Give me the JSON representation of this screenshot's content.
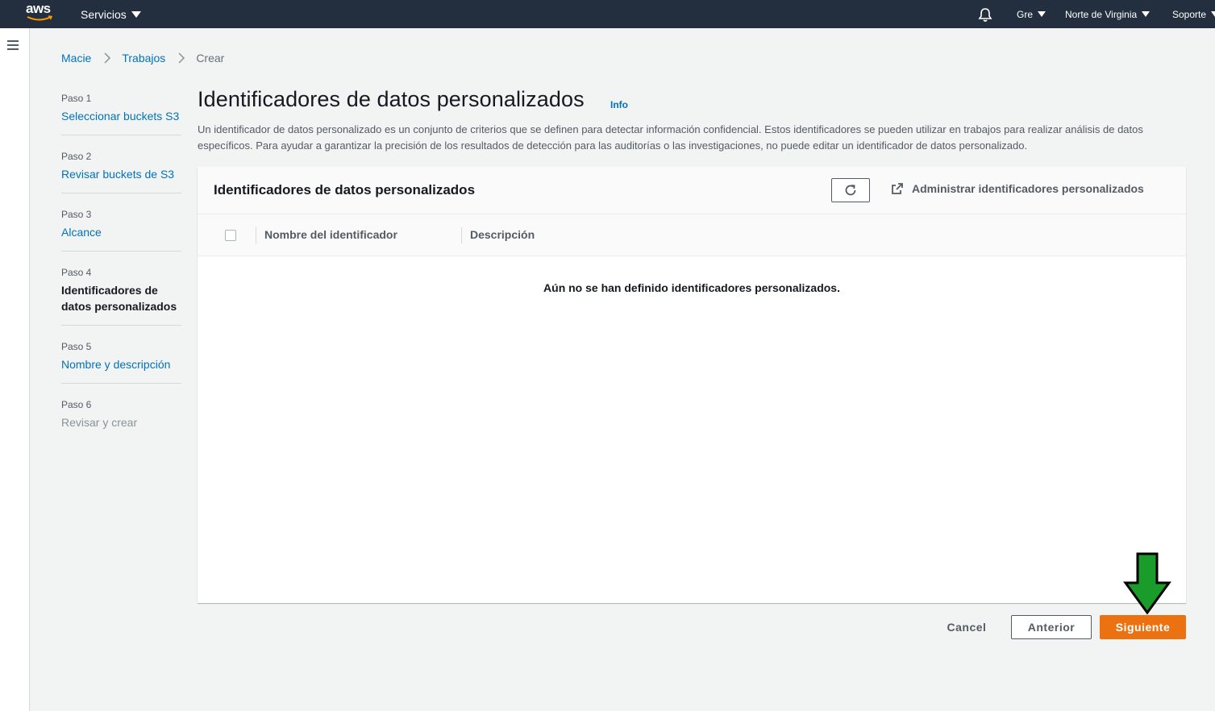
{
  "topnav": {
    "logo_text": "aws",
    "services": "Servicios",
    "user": "Gre",
    "region": "Norte de Virginia",
    "support": "Soporte",
    "bg_color": "#232f3e"
  },
  "breadcrumb": {
    "items": [
      "Macie",
      "Trabajos"
    ],
    "current": "Crear"
  },
  "steps": [
    {
      "num": "Paso 1",
      "label": "Seleccionar buckets S3",
      "state": "link"
    },
    {
      "num": "Paso 2",
      "label": "Revisar buckets de S3",
      "state": "link"
    },
    {
      "num": "Paso 3",
      "label": "Alcance",
      "state": "link"
    },
    {
      "num": "Paso 4",
      "label": "Identificadores de datos personalizados",
      "state": "current"
    },
    {
      "num": "Paso 5",
      "label": "Nombre y descripción",
      "state": "link"
    },
    {
      "num": "Paso 6",
      "label": "Revisar y crear",
      "state": "disabled"
    }
  ],
  "page": {
    "title": "Identificadores de datos personalizados",
    "info": "Info",
    "description": "Un identificador de datos personalizado es un conjunto de criterios que se definen para detectar información confidencial. Estos identificadores se pueden utilizar en trabajos para realizar análisis de datos específicos. Para ayudar a garantizar la precisión de los resultados de detección para las auditorías o las investigaciones, no puede editar un identificador de datos personalizado."
  },
  "container": {
    "title": "Identificadores de datos personalizados",
    "manage_link": "Administrar identificadores personalizados",
    "columns": [
      "Nombre del identificador",
      "Descripción"
    ],
    "empty_message": "Aún no se han definido identificadores personalizados."
  },
  "footer": {
    "cancel": "Cancel",
    "previous": "Anterior",
    "next": "Siguiente"
  },
  "colors": {
    "primary_button": "#ec7211",
    "link": "#0073bb",
    "annotation_arrow": "#1a9c2a"
  },
  "icons": [
    "bell-icon",
    "hamburger-icon",
    "chevron-right-icon",
    "refresh-icon",
    "external-link-icon",
    "down-arrow-annotation"
  ]
}
